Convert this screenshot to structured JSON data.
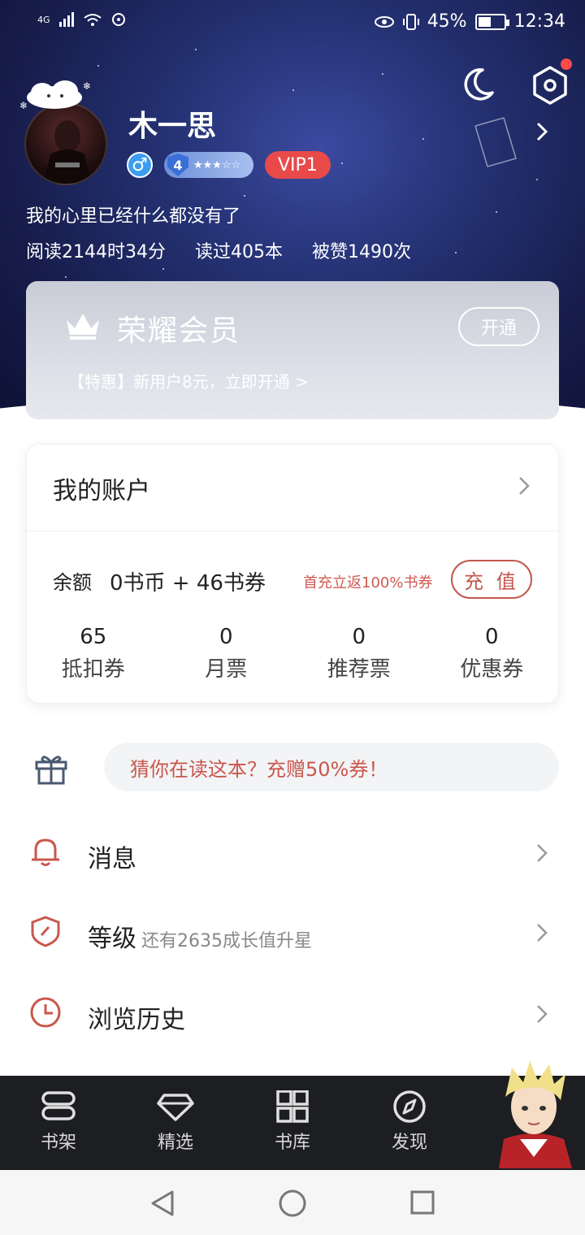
{
  "status_bar": {
    "network": "4G",
    "battery": "45%",
    "time": "12:34"
  },
  "profile": {
    "username": "木一思",
    "gender_symbol": "♂",
    "level": "4",
    "vip": "VIP1",
    "bio": "我的心里已经什么都没有了",
    "stats": [
      "阅读2144时34分",
      "读过405本",
      "被赞1490次"
    ]
  },
  "vip_card": {
    "title": "荣耀会员",
    "promo": "【特惠】新用户8元，立即开通 >",
    "button": "开通"
  },
  "account": {
    "title": "我的账户",
    "balance_label": "余额",
    "balance_value": "0书币 + 46书券",
    "first_pay": "首充立返100%书券",
    "charge_button": "充 值",
    "items": [
      {
        "value": "65",
        "label": "抵扣券"
      },
      {
        "value": "0",
        "label": "月票"
      },
      {
        "value": "0",
        "label": "推荐票"
      },
      {
        "value": "0",
        "label": "优惠券"
      }
    ]
  },
  "promo_pill": "猜你在读这本？充赠50%券！",
  "menu": {
    "messages": "消息",
    "level": "等级",
    "level_sub": "还有2635成长值升星",
    "history": "浏览历史"
  },
  "bottom_nav": [
    "书架",
    "精选",
    "书库",
    "发现"
  ],
  "colors": {
    "accent_red": "#c9574d",
    "vip_red": "#e84a4a",
    "nav_bg": "#1d1e22"
  }
}
